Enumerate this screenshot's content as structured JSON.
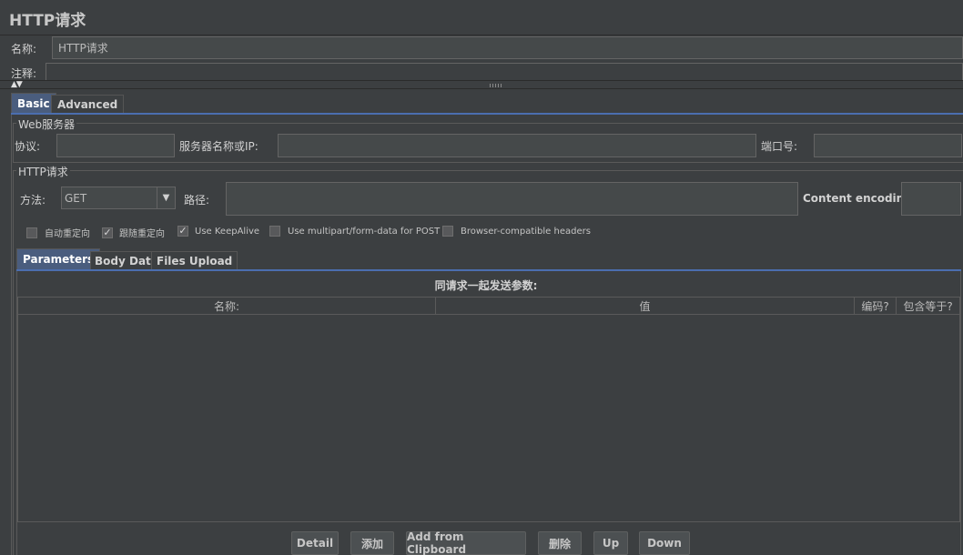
{
  "panel": {
    "title": "HTTP请求"
  },
  "name_row": {
    "label": "名称:",
    "value": "HTTP请求"
  },
  "comment_row": {
    "label": "注释:",
    "value": ""
  },
  "main_tabs": [
    {
      "label": "Basic",
      "selected": true
    },
    {
      "label": "Advanced",
      "selected": false
    }
  ],
  "web_server": {
    "title": "Web服务器",
    "protocol_label": "协议:",
    "protocol_value": "",
    "server_label": "服务器名称或IP:",
    "server_value": "",
    "port_label": "端口号:",
    "port_value": ""
  },
  "http_request": {
    "title": "HTTP请求",
    "method_label": "方法:",
    "method_value": "GET",
    "path_label": "路径:",
    "path_value": "",
    "encoding_label": "Content encoding:",
    "encoding_value": ""
  },
  "options": [
    {
      "label": "自动重定向",
      "checked": false
    },
    {
      "label": "跟随重定向",
      "checked": true
    },
    {
      "label": "Use KeepAlive",
      "checked": true
    },
    {
      "label": "Use multipart/form-data for POST",
      "checked": false
    },
    {
      "label": "Browser-compatible headers",
      "checked": false
    }
  ],
  "sub_tabs": [
    {
      "label": "Parameters",
      "selected": true
    },
    {
      "label": "Body Data",
      "selected": false
    },
    {
      "label": "Files Upload",
      "selected": false
    }
  ],
  "params_table": {
    "caption": "同请求一起发送参数:",
    "columns": [
      "名称:",
      "值",
      "编码?",
      "包含等于?"
    ],
    "rows": []
  },
  "buttons": {
    "detail": "Detail",
    "add": "添加",
    "add_clipboard": "Add from Clipboard",
    "delete": "删除",
    "up": "Up",
    "down": "Down"
  },
  "colors": {
    "background": "#3c3f41",
    "field": "#45494a",
    "selected_tab": "#4a5d7e",
    "accent": "#4b6eaf"
  }
}
